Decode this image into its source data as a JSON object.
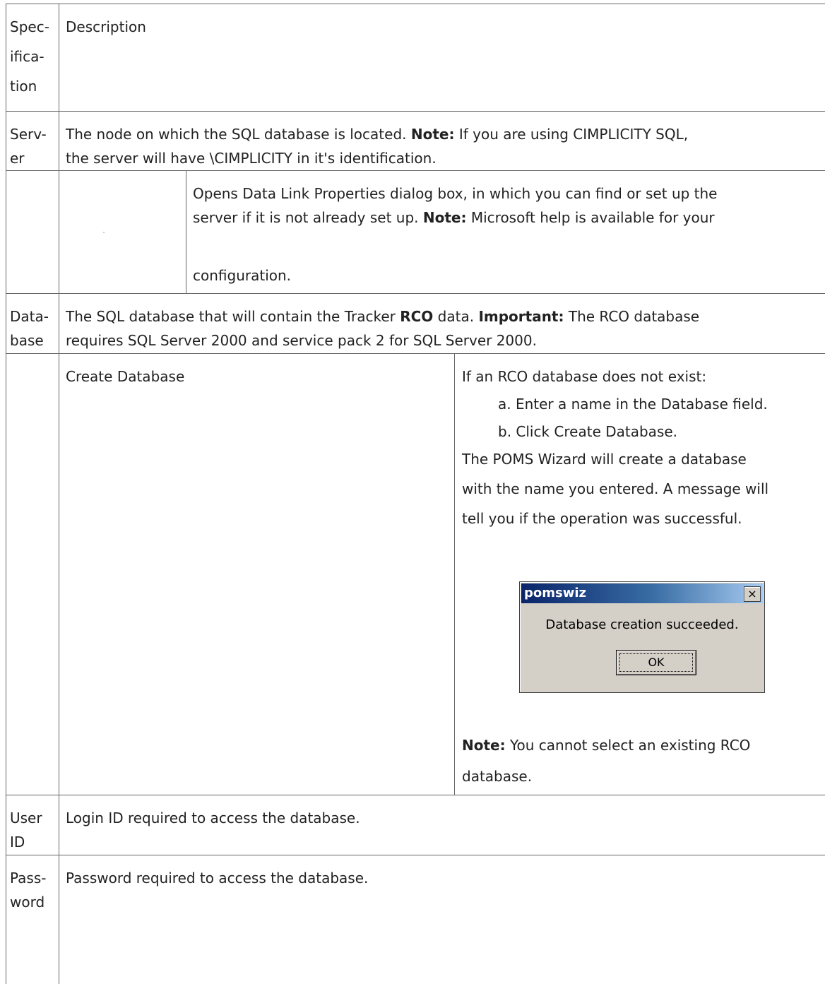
{
  "header": {
    "col1_lines": [
      "Spec-",
      "ifica-",
      "tion"
    ],
    "col2": "Description"
  },
  "server": {
    "spec_lines": [
      "Serv-",
      "er"
    ],
    "desc_line1_prefix": "The node on which the SQL database is located. ",
    "desc_note_label": "Note:",
    "desc_line1_suffix": " If you are using CIMPLICITY SQL,",
    "desc_line2": "the server will have \\CIMPLICITY in it's identification."
  },
  "server_button_row": {
    "line1": "Opens Data Link Properties dialog box, in which you can find or set up the",
    "line2_prefix": "server if it is not already set up. ",
    "line2_note_label": "Note:",
    "line2_suffix": " Microsoft help is available for your",
    "line3": "configuration."
  },
  "database": {
    "spec_lines": [
      "Data-",
      "base"
    ],
    "line1_prefix": "The SQL database that will contain the Tracker ",
    "line1_bold": "RCO",
    "line1_mid": " data. ",
    "line1_important_label": "Important:",
    "line1_suffix": " The RCO database",
    "line2": "requires SQL Server 2000 and service pack 2 for SQL Server 2000."
  },
  "create_database": {
    "label": "Create Database",
    "intro": "If an RCO database does not exist:",
    "steps": [
      "a. Enter a name in the Database field.",
      "b. Click Create Database."
    ],
    "result_lines": [
      "The POMS Wizard will create a database",
      "with the name you entered. A message will",
      "tell you if the operation was successful."
    ],
    "dialog": {
      "title": "pomswiz",
      "close_glyph": "×",
      "message": "Database creation succeeded.",
      "ok_label": "OK"
    },
    "note_label": "Note:",
    "note_line1": " You cannot select an existing RCO",
    "note_line2": "database."
  },
  "user_id": {
    "spec_lines": [
      "User",
      "ID"
    ],
    "desc": "Login ID required to access the database."
  },
  "password": {
    "spec_lines": [
      "Pass-",
      "word"
    ],
    "desc": "Password required to access the database."
  }
}
